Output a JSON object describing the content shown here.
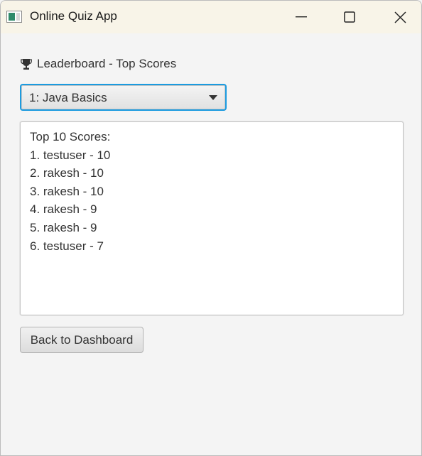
{
  "window": {
    "title": "Online Quiz App",
    "icons": {
      "app": "app-window-icon",
      "minimize": "minimize-icon",
      "maximize": "maximize-icon",
      "close": "close-icon"
    }
  },
  "leaderboard": {
    "heading_icon": "trophy-icon",
    "heading": "Leaderboard - Top Scores",
    "quiz_selector": {
      "selected": "1: Java Basics",
      "arrow_icon": "dropdown-arrow-icon"
    },
    "scores_header": "Top 10 Scores:",
    "scores": [
      "1. testuser - 10",
      "2. rakesh - 10",
      "3. rakesh - 10",
      "4. rakesh - 9",
      "5. rakesh - 9",
      "6. testuser - 7"
    ],
    "back_button": "Back to Dashboard"
  },
  "colors": {
    "focus_accent": "#1b9be0",
    "titlebar_bg": "#f8f4e8",
    "window_bg": "#f4f4f4",
    "text": "#333333"
  }
}
